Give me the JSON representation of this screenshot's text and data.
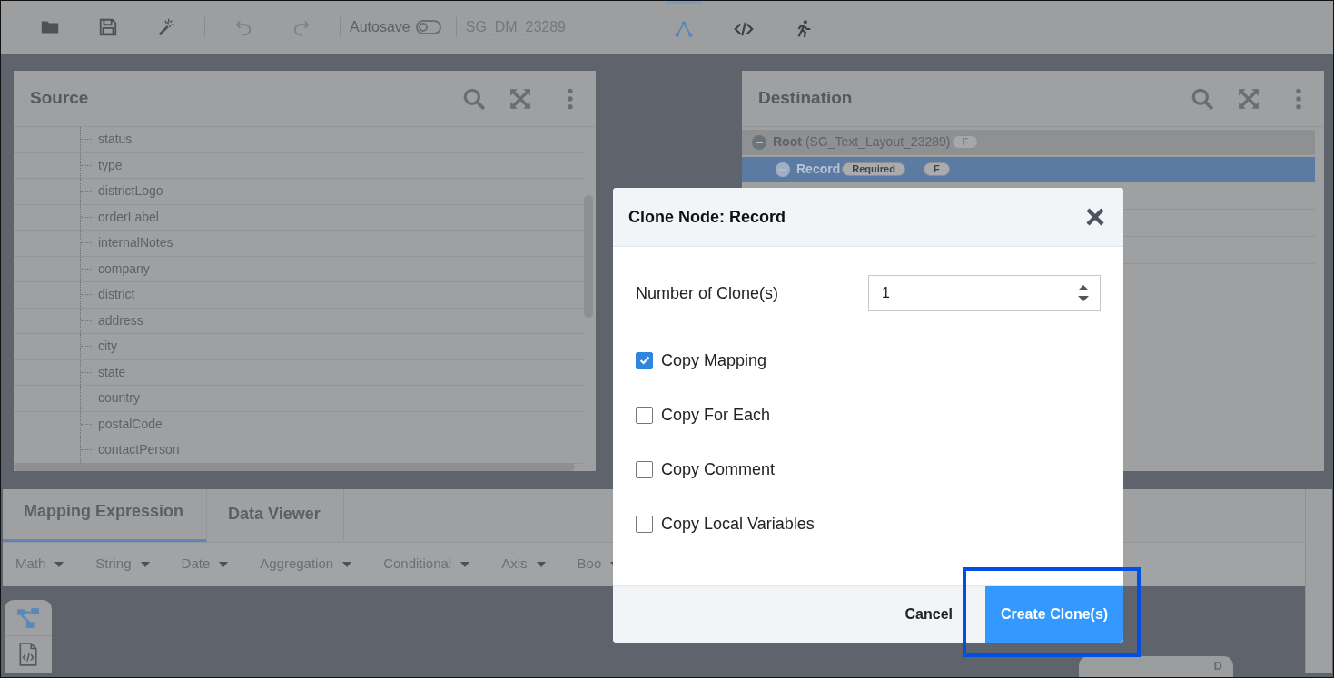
{
  "toolbar": {
    "autosave_label": "Autosave",
    "autosave_on": false,
    "document_name": "SG_DM_23289"
  },
  "view_modes": [
    {
      "kind": "mapping",
      "selected": true
    },
    {
      "kind": "code",
      "selected": false
    },
    {
      "kind": "run",
      "selected": false
    }
  ],
  "source": {
    "title": "Source",
    "items": [
      "status",
      "type",
      "districtLogo",
      "orderLabel",
      "internalNotes",
      "company",
      "district",
      "address",
      "city",
      "state",
      "country",
      "postalCode",
      "contactPerson"
    ]
  },
  "destination": {
    "title": "Destination",
    "tree": [
      {
        "name": "Root",
        "detail": "(SG_Text_Layout_23289)",
        "badges": [
          "F"
        ],
        "selected": false,
        "expanded": true,
        "children": [
          {
            "name": "Record",
            "badges": [
              "Required",
              "F"
            ],
            "selected": true,
            "expanded": true
          }
        ]
      }
    ]
  },
  "bottom_tabs": [
    {
      "label": "Mapping Expression",
      "selected": true
    },
    {
      "label": "Data Viewer",
      "selected": false
    }
  ],
  "function_menus": [
    "Math",
    "String",
    "Date",
    "Aggregation",
    "Conditional",
    "Axis",
    "Boo"
  ],
  "side_tab_label": "D",
  "dialog": {
    "title": "Clone Node: Record",
    "number_label": "Number of Clone(s)",
    "number_value": "1",
    "options": [
      {
        "label": "Copy Mapping",
        "checked": true
      },
      {
        "label": "Copy For Each",
        "checked": false
      },
      {
        "label": "Copy Comment",
        "checked": false
      },
      {
        "label": "Copy Local Variables",
        "checked": false
      }
    ],
    "buttons": [
      {
        "label": "Cancel",
        "kind": "secondary",
        "highlighted": false
      },
      {
        "label": "Create Clone(s)",
        "kind": "primary",
        "highlighted": true
      }
    ]
  }
}
